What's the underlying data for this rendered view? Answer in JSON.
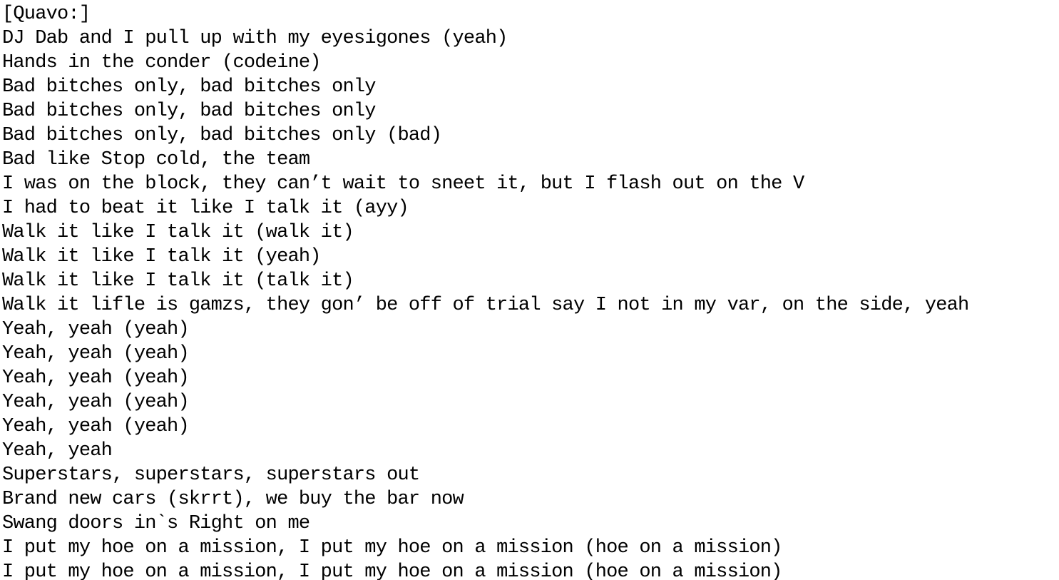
{
  "document": {
    "lines": [
      "[Quavo:]",
      "DJ Dab and I pull up with my eyesigones (yeah)",
      "Hands in the conder (codeine)",
      "Bad bitches only, bad bitches only",
      "Bad bitches only, bad bitches only",
      "Bad bitches only, bad bitches only (bad)",
      "Bad like Stop cold, the team",
      "I was on the block, they can’t wait to sneet it, but I flash out on the V",
      "I had to beat it like I talk it (ayy)",
      "Walk it like I talk it (walk it)",
      "Walk it like I talk it (yeah)",
      "Walk it like I talk it (talk it)",
      "Walk it lifle is gamzs, they gon’ be off of trial say I not in my var, on the side, yeah",
      "Yeah, yeah (yeah)",
      "Yeah, yeah (yeah)",
      "Yeah, yeah (yeah)",
      "Yeah, yeah (yeah)",
      "Yeah, yeah (yeah)",
      "Yeah, yeah",
      "Superstars, superstars, superstars out",
      "Brand new cars (skrrt), we buy the bar now",
      "Swang doors in`s Right on me",
      "I put my hoe on a mission, I put my hoe on a mission (hoe on a mission)",
      "I put my hoe on a mission, I put my hoe on a mission (hoe on a mission)"
    ]
  }
}
